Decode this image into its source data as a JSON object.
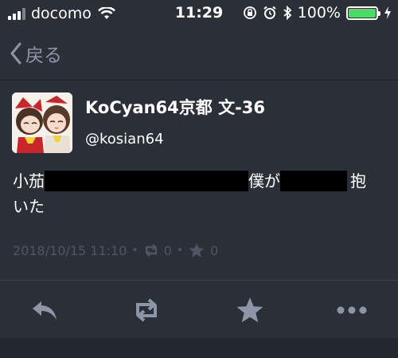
{
  "status_bar": {
    "carrier": "docomo",
    "time": "11:29",
    "battery_percent": "100%",
    "battery_level": 1.0
  },
  "nav": {
    "back_label": "戻る"
  },
  "tweet": {
    "display_name": "KoCyan64京都 文-36",
    "handle": "@kosian64",
    "text_part1": "小茄",
    "text_part2": "僕が",
    "text_part3": "抱",
    "text_line2": "いた",
    "timestamp": "2018/10/15 11:10",
    "retweet_count": "0",
    "favorite_count": "0"
  },
  "colors": {
    "background": "#2b3038",
    "muted": "#4e5663",
    "icon": "#8c96a6",
    "battery": "#4cd964"
  },
  "toolbar": {
    "icons": [
      "reply-icon",
      "retweet-icon",
      "favorite-icon",
      "more-icon"
    ]
  }
}
